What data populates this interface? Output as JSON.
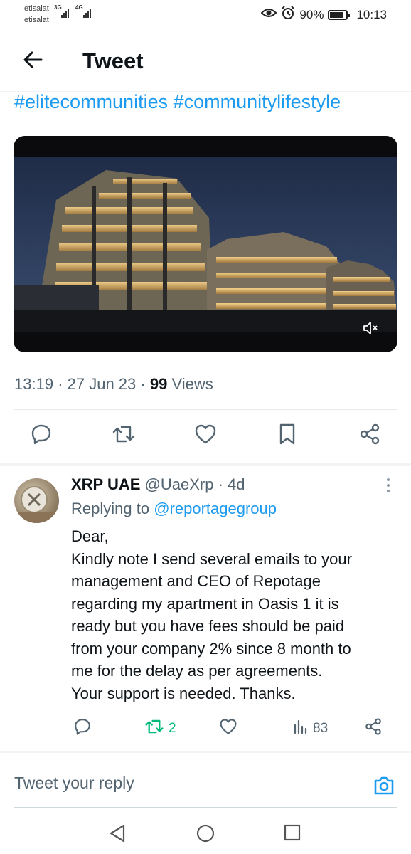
{
  "status": {
    "carrier1": "etisalat",
    "carrier2": "etisalat",
    "net1": "3G",
    "net2": "4G",
    "battery": "90%",
    "time": "10:13"
  },
  "header": {
    "title": "Tweet"
  },
  "tweet": {
    "hashtags": [
      "#elitecommunities",
      "#communitylifestyle"
    ],
    "time": "13:19",
    "date": "27 Jun 23",
    "views_count": "99",
    "views_label": "Views"
  },
  "reply": {
    "name": "XRP UAE",
    "handle": "@UaeXrp",
    "age": "4d",
    "replying_prefix": "Replying to",
    "replying_to": "@reportagegroup",
    "body_lines": [
      "Dear,",
      "Kindly note I send several emails to your",
      "management and CEO of Repotage",
      "regarding my apartment in Oasis 1 it is",
      "ready but you have fees should be paid",
      "from your company 2% since 8 month to",
      "me for the delay as per agreements.",
      "Your support is needed. Thanks."
    ],
    "retweets": "2",
    "views": "83"
  },
  "compose": {
    "placeholder": "Tweet your reply"
  },
  "colors": {
    "accent": "#1d9bf0",
    "retweet": "#00ba7c",
    "muted": "#536471"
  }
}
